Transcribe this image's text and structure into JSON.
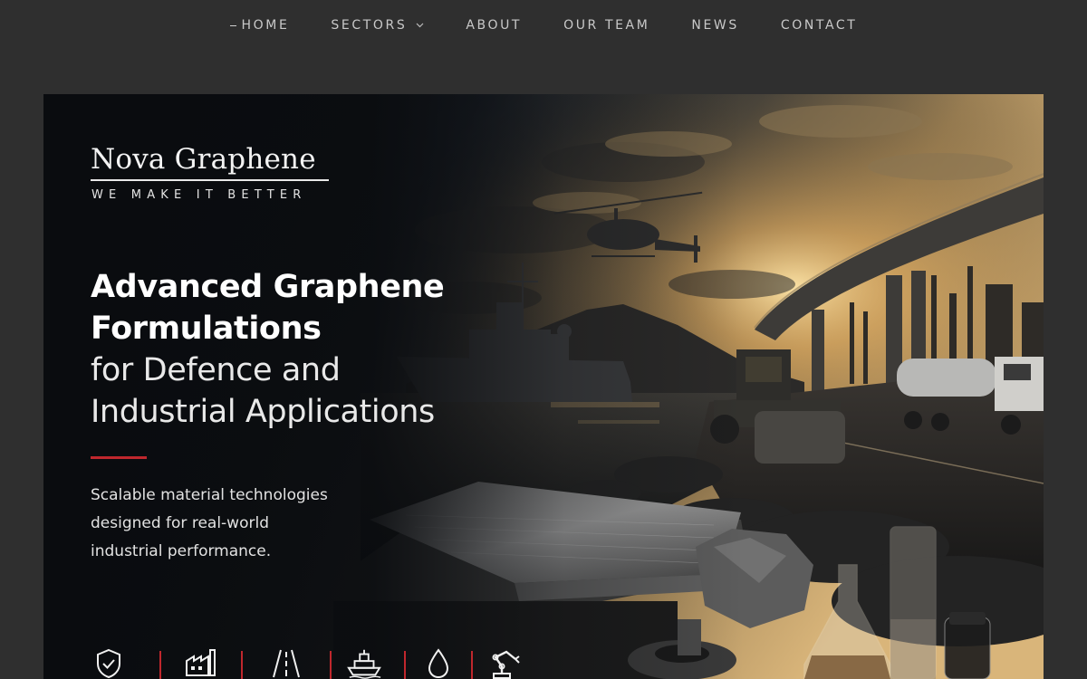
{
  "nav": {
    "items": [
      {
        "label": "HOME",
        "active": true
      },
      {
        "label": "SECTORS",
        "has_dropdown": true
      },
      {
        "label": "ABOUT"
      },
      {
        "label": "OUR TEAM"
      },
      {
        "label": "NEWS"
      },
      {
        "label": "CONTACT"
      }
    ]
  },
  "hero": {
    "brand_name": "Nova Graphene",
    "brand_tagline": "WE MAKE IT BETTER",
    "headline_bold": [
      "Advanced Graphene",
      "Formulations"
    ],
    "headline_light": [
      "for Defence and",
      "Industrial Applications"
    ],
    "subtext": [
      "Scalable material technologies",
      "designed for real-world",
      "industrial performance."
    ],
    "sector_icons": [
      "shield-check-icon",
      "factory-icon",
      "road-icon",
      "ship-icon",
      "droplet-icon",
      "robot-arm-icon"
    ]
  },
  "colors": {
    "page_background": "#2f2f2f",
    "accent_red": "#c0272d",
    "nav_text": "#c9c9c9"
  }
}
